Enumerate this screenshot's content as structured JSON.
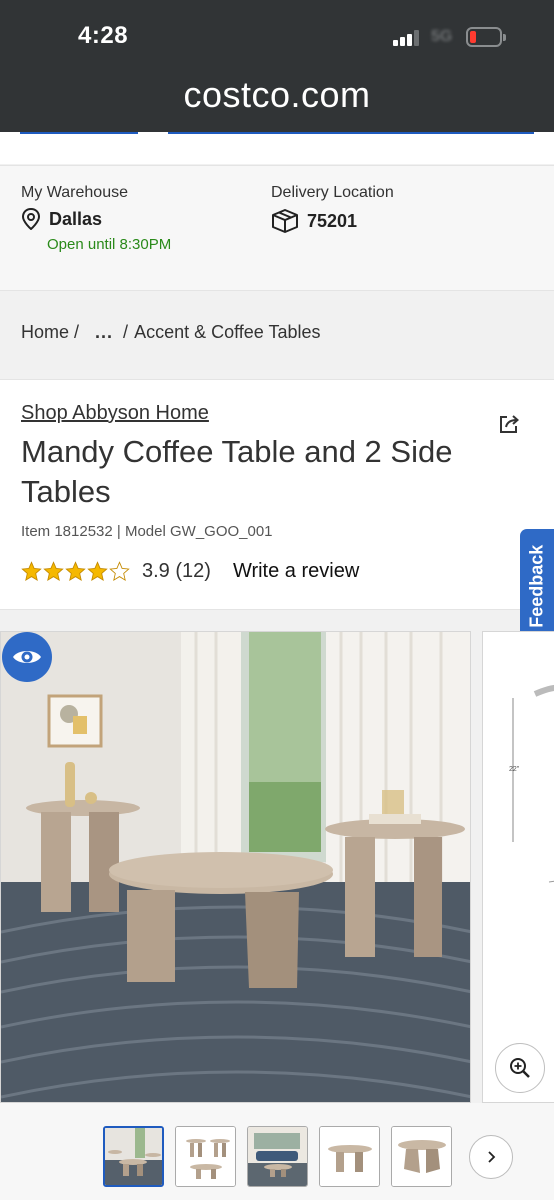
{
  "status_bar": {
    "time": "4:28",
    "network": "5G",
    "battery_level": 0.1,
    "battery_color": "#ff3b30"
  },
  "browser": {
    "url": "costco.com"
  },
  "location": {
    "warehouse_label": "My Warehouse",
    "warehouse_name": "Dallas",
    "warehouse_hours": "Open until 8:30PM",
    "delivery_label": "Delivery Location",
    "delivery_zip": "75201",
    "open_color": "#2a8a1a"
  },
  "breadcrumb": {
    "home": "Home /",
    "ellipsis": "...",
    "separator": "/",
    "current": "Accent & Coffee Tables"
  },
  "product": {
    "shop_link": "Shop Abbyson Home",
    "title": "Mandy Coffee Table and 2 Side Tables",
    "item_model": "Item 1812532 | Model GW_GOO_001",
    "rating": 3.9,
    "rating_text": "3.9 (12)",
    "write_review": "Write a review",
    "stars_filled": 4,
    "stars_total": 5
  },
  "feedback": {
    "label": "[+] Feedback"
  },
  "gallery": {
    "side_dimension": "22\"",
    "thumbnail_count": 5,
    "selected_thumbnail": 1
  },
  "colors": {
    "accent_blue": "#2f6ac6",
    "topbar": "#313436",
    "star": "#f5b800"
  },
  "icons": {
    "location": "pin-icon",
    "delivery": "box-icon",
    "share": "share-icon",
    "view": "eye-icon",
    "zoom": "zoom-in-icon",
    "next": "chevron-right-icon"
  }
}
